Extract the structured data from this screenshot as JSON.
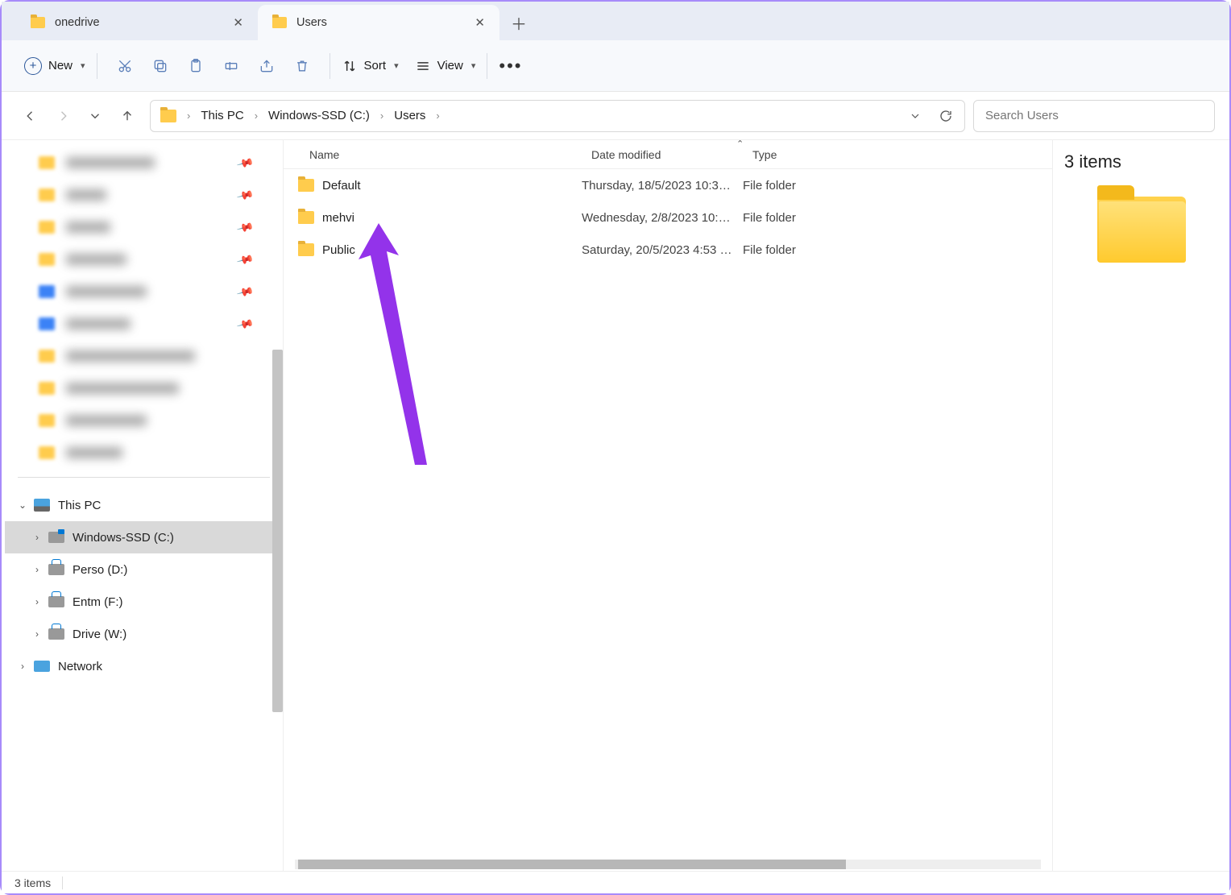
{
  "tabs": [
    {
      "title": "onedrive",
      "active": false
    },
    {
      "title": "Users",
      "active": true
    }
  ],
  "toolbar": {
    "new_label": "New",
    "sort_label": "Sort",
    "view_label": "View"
  },
  "breadcrumbs": [
    "This PC",
    "Windows-SSD (C:)",
    "Users"
  ],
  "search_placeholder": "Search Users",
  "columns": {
    "name": "Name",
    "date": "Date modified",
    "type": "Type"
  },
  "files": [
    {
      "name": "Default",
      "date": "Thursday, 18/5/2023 10:3…",
      "type": "File folder"
    },
    {
      "name": "mehvi",
      "date": "Wednesday, 2/8/2023 10:…",
      "type": "File folder"
    },
    {
      "name": "Public",
      "date": "Saturday, 20/5/2023 4:53 …",
      "type": "File folder"
    }
  ],
  "tree": {
    "this_pc": "This PC",
    "drives": [
      {
        "label": "Windows-SSD (C:)",
        "selected": true,
        "kind": "ssd"
      },
      {
        "label": "Perso (D:)",
        "selected": false,
        "kind": "usb"
      },
      {
        "label": "Entm (F:)",
        "selected": false,
        "kind": "usb"
      },
      {
        "label": "Drive  (W:)",
        "selected": false,
        "kind": "usb"
      }
    ],
    "network": "Network"
  },
  "details": {
    "title": "3 items"
  },
  "status": {
    "count": "3 items"
  }
}
